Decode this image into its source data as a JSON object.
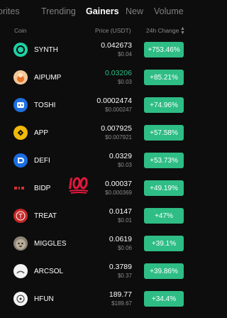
{
  "tabs": [
    {
      "label": "orites",
      "active": false
    },
    {
      "label": "Trending",
      "active": false
    },
    {
      "label": "Gainers",
      "active": true
    },
    {
      "label": "New",
      "active": false
    },
    {
      "label": "Volume",
      "active": false
    }
  ],
  "header": {
    "coin": "Coin",
    "price": "Price (USDT)",
    "change": "24h Change"
  },
  "accent_colors": {
    "up": "#2ebd85",
    "muted": "#8a8a8a",
    "background": "#0d0d0d"
  },
  "rows": [
    {
      "symbol": "SYNTH",
      "price": "0.042673",
      "sub": "$0.04",
      "change": "+753.46%",
      "icon": "synth-icon",
      "price_green": false
    },
    {
      "symbol": "AIPUMP",
      "price": "0.03206",
      "sub": "$0.03",
      "change": "+85.21%",
      "icon": "aipump-icon",
      "price_green": true
    },
    {
      "symbol": "TOSHI",
      "price": "0.0002474",
      "sub": "$0.000247",
      "change": "+74.96%",
      "icon": "toshi-icon",
      "price_green": false
    },
    {
      "symbol": "APP",
      "price": "0.007925",
      "sub": "$0.007921",
      "change": "+57.58%",
      "icon": "app-icon",
      "price_green": false
    },
    {
      "symbol": "DEFI",
      "price": "0.0329",
      "sub": "$0.03",
      "change": "+53.73%",
      "icon": "defi-icon",
      "price_green": false
    },
    {
      "symbol": "BIDP",
      "price": "0.00037",
      "sub": "$0.000369",
      "change": "+49.19%",
      "icon": "bidp-icon",
      "price_green": false
    },
    {
      "symbol": "TREAT",
      "price": "0.0147",
      "sub": "$0.01",
      "change": "+47%",
      "icon": "treat-icon",
      "price_green": false
    },
    {
      "symbol": "MIGGLES",
      "price": "0.0619",
      "sub": "$0.06",
      "change": "+39.1%",
      "icon": "miggles-icon",
      "price_green": false
    },
    {
      "symbol": "ARCSOL",
      "price": "0.3789",
      "sub": "$0.37",
      "change": "+39.86%",
      "icon": "arcsol-icon",
      "price_green": false
    },
    {
      "symbol": "HFUN",
      "price": "189.77",
      "sub": "$189.67",
      "change": "+34.4%",
      "icon": "hfun-icon",
      "price_green": false
    }
  ],
  "decoration": {
    "emoji": "100-emoji"
  }
}
